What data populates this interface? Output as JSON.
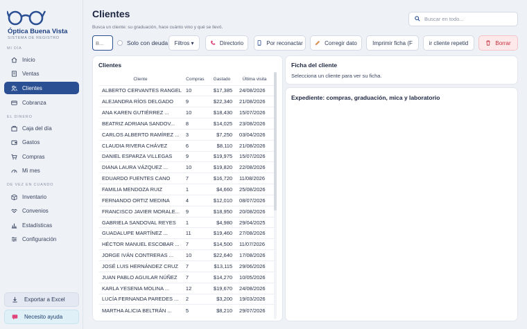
{
  "brand": {
    "name": "Óptica Buena Vista",
    "subtitle": "SISTEMA DE REGISTRO"
  },
  "sidebar": {
    "sections": [
      "MI DÍA",
      "EL DINERO",
      "DE VEZ EN CUANDO"
    ],
    "items": [
      {
        "label": "Inicio",
        "icon": "home-icon"
      },
      {
        "label": "Ventas",
        "icon": "document-icon"
      },
      {
        "label": "Clientes",
        "icon": "users-icon"
      },
      {
        "label": "Cobranza",
        "icon": "card-icon"
      },
      {
        "label": "Caja del día",
        "icon": "cash-box-icon"
      },
      {
        "label": "Gastos",
        "icon": "wallet-icon"
      },
      {
        "label": "Compras",
        "icon": "cart-icon"
      },
      {
        "label": "Mi mes",
        "icon": "gauge-icon"
      },
      {
        "label": "Inventario",
        "icon": "box-icon"
      },
      {
        "label": "Convenios",
        "icon": "handshake-icon"
      },
      {
        "label": "Estadísticas",
        "icon": "bar-chart-icon"
      },
      {
        "label": "Configuración",
        "icon": "sliders-icon"
      }
    ],
    "active": "Clientes",
    "export_label": "Exportar a Excel",
    "help_label": "Necesito ayuda"
  },
  "header": {
    "title": "Clientes",
    "subtitle": "Busca un cliente: su graduación, hace cuánto vino y qué se llevó.",
    "search_placeholder": "Buscar en todo..."
  },
  "toolbar": {
    "input_value": "",
    "input_placeholder": "B...",
    "only_debt_label": "Solo con deuda",
    "filters_label": "Filtros ▾",
    "directory_label": "Directorio",
    "recontact_label": "Por reconactar",
    "fix_label": "Corregir dato",
    "print_label": "Imprimir ficha (F",
    "repeated_label": "ir cliente repetid",
    "delete_label": "Borrar"
  },
  "clients": {
    "title": "Clientes",
    "columns": [
      "Cliente",
      "Compras",
      "Gastado",
      "Última visita"
    ],
    "rows": [
      [
        "ALBERTO CERVANTES RANGEL",
        "10",
        "$17,385",
        "24/08/2026"
      ],
      [
        "ALEJANDRA RÍOS DELGADO",
        "9",
        "$22,340",
        "21/08/2026"
      ],
      [
        "ANA KAREN GUTIÉRREZ ...",
        "10",
        "$18,430",
        "15/07/2026"
      ],
      [
        "BEATRIZ ADRIANA SANDOV...",
        "8",
        "$14,025",
        "23/08/2026"
      ],
      [
        "CARLOS ALBERTO RAMÍREZ ...",
        "3",
        "$7,250",
        "03/04/2026"
      ],
      [
        "CLAUDIA RIVERA CHÁVEZ",
        "6",
        "$8,110",
        "21/08/2026"
      ],
      [
        "DANIEL ESPARZA VILLEGAS",
        "9",
        "$19,975",
        "15/07/2026"
      ],
      [
        "DIANA LAURA VÁZQUEZ ...",
        "10",
        "$19,820",
        "22/08/2026"
      ],
      [
        "EDUARDO FUENTES CANO",
        "7",
        "$16,720",
        "11/08/2026"
      ],
      [
        "FAMILIA MENDOZA RUIZ",
        "1",
        "$4,660",
        "25/08/2026"
      ],
      [
        "FERNANDO ORTIZ MEDINA",
        "4",
        "$12,010",
        "08/07/2026"
      ],
      [
        "FRANCISCO JAVIER MORALE...",
        "9",
        "$18,950",
        "20/08/2026"
      ],
      [
        "GABRIELA SANDOVAL REYES",
        "1",
        "$4,980",
        "29/04/2025"
      ],
      [
        "GUADALUPE MARTÍNEZ ...",
        "11",
        "$19,460",
        "27/08/2026"
      ],
      [
        "HÉCTOR MANUEL ESCOBAR ...",
        "7",
        "$14,500",
        "11/07/2026"
      ],
      [
        "JORGE IVÁN CONTRERAS ...",
        "10",
        "$22,640",
        "17/08/2026"
      ],
      [
        "JOSÉ LUIS HERNÁNDEZ CRUZ",
        "7",
        "$13,115",
        "29/06/2026"
      ],
      [
        "JUAN PABLO AGUILAR NÚÑEZ",
        "7",
        "$14,270",
        "10/05/2026"
      ],
      [
        "KARLA YESENIA MOLINA ...",
        "12",
        "$19,670",
        "24/08/2026"
      ],
      [
        "LUCÍA FERNANDA PAREDES ...",
        "2",
        "$3,200",
        "19/03/2026"
      ],
      [
        "MARTHA ALICIA BELTRÁN ...",
        "5",
        "$8,210",
        "29/07/2026"
      ]
    ]
  },
  "ficha": {
    "title": "Ficha del cliente",
    "hint": "Selecciona un cliente para ver su ficha."
  },
  "expediente": {
    "title": "Expediente: compras, graduación, mica y laboratorio"
  },
  "colors": {
    "accent": "#2a4f92",
    "danger": "#c4303b",
    "background": "#eef1f6"
  }
}
